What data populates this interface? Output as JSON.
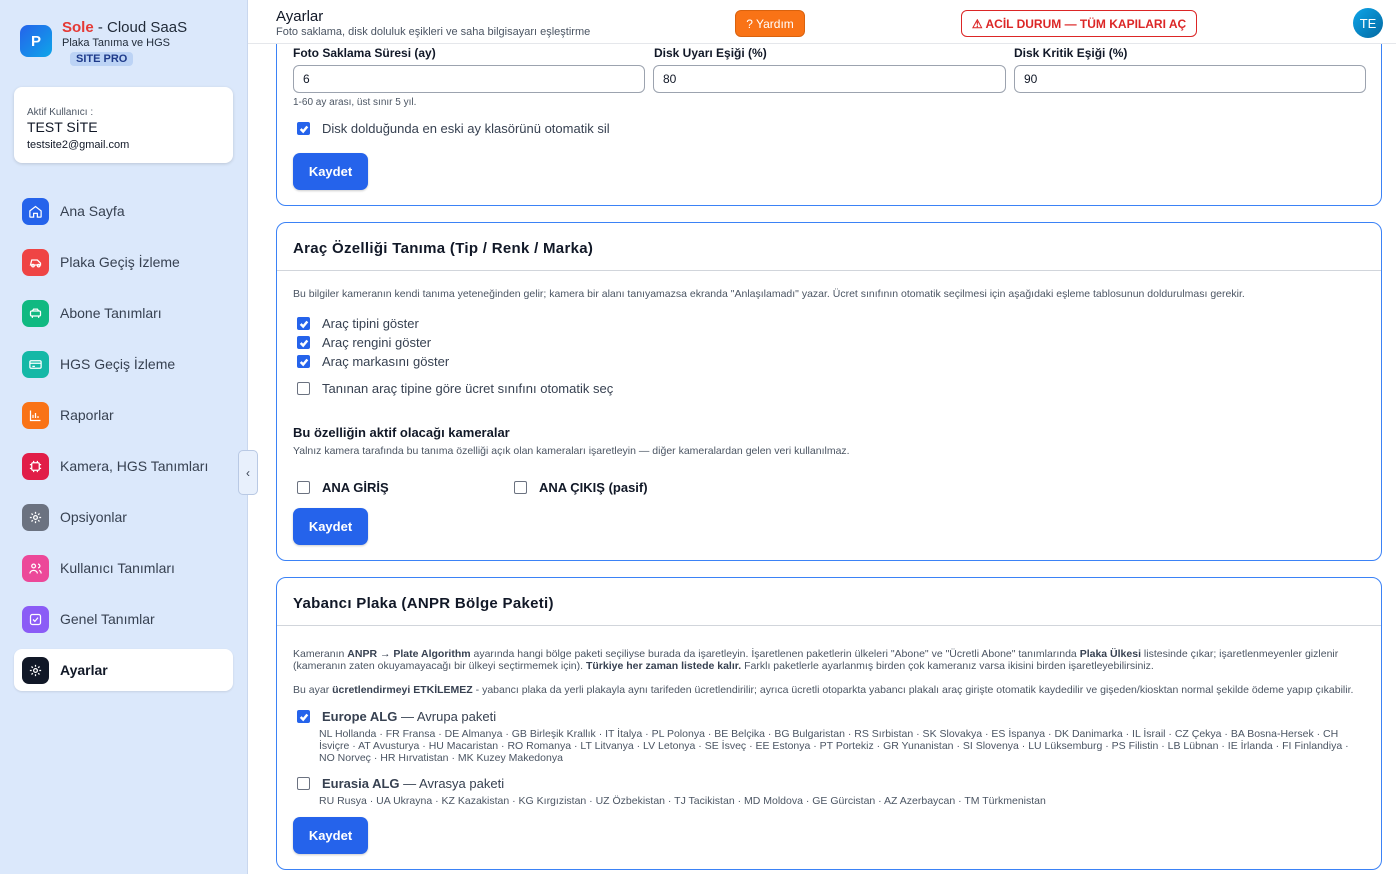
{
  "sidebar": {
    "brand": {
      "logo_letter": "P",
      "name_red": "Sole",
      "name_rest": " - Cloud SaaS",
      "subtitle": "Plaka Tanıma ve HGS",
      "badge": "SITE PRO"
    },
    "user": {
      "label": "Aktif Kullanıcı :",
      "name": "TEST SİTE",
      "email": "testsite2@gmail.com"
    },
    "items": [
      {
        "label": "Ana Sayfa",
        "icon": "home-icon",
        "color": "#2563eb"
      },
      {
        "label": "Plaka Geçiş İzleme",
        "icon": "car-icon",
        "color": "#ef4444"
      },
      {
        "label": "Abone Tanımları",
        "icon": "vehicle-icon",
        "color": "#10b981"
      },
      {
        "label": "HGS Geçiş İzleme",
        "icon": "card-icon",
        "color": "#14b8a6"
      },
      {
        "label": "Raporlar",
        "icon": "chart-icon",
        "color": "#f97316"
      },
      {
        "label": "Kamera, HGS Tanımları",
        "icon": "chip-icon",
        "color": "#e11d48"
      },
      {
        "label": "Opsiyonlar",
        "icon": "gear-icon",
        "color": "#6b7280"
      },
      {
        "label": "Kullanıcı Tanımları",
        "icon": "users-icon",
        "color": "#ec4899"
      },
      {
        "label": "Genel Tanımlar",
        "icon": "checklist-icon",
        "color": "#8b5cf6"
      },
      {
        "label": "Ayarlar",
        "icon": "settings-icon",
        "color": "#111827",
        "active": true
      }
    ],
    "collapse": "‹"
  },
  "header": {
    "title": "Ayarlar",
    "subtitle": "Foto saklama, disk doluluk eşikleri ve saha bilgisayarı eşleştirme",
    "help_label": "? Yardım",
    "emergency_label": "⚠ ACİL DURUM — TÜM KAPILARI AÇ",
    "avatar": "TE"
  },
  "storage": {
    "photo_label": "Foto Saklama Süresi (ay)",
    "photo_value": "6",
    "warn_label": "Disk Uyarı Eşiği (%)",
    "warn_value": "80",
    "crit_label": "Disk Kritik Eşiği (%)",
    "crit_value": "90",
    "hint": "1-60 ay arası, üst sınır 5 yıl.",
    "auto_delete_label": "Disk dolduğunda en eski ay klasörünü otomatik sil",
    "save": "Kaydet"
  },
  "vehicle": {
    "title": "Araç Özelliği Tanıma (Tip / Renk / Marka)",
    "desc": "Bu bilgiler kameranın kendi tanıma yeteneğinden gelir; kamera bir alanı tanıyamazsa ekranda \"Anlaşılamadı\" yazar. Ücret sınıfının otomatik seçilmesi için aşağıdaki eşleme tablosunun doldurulması gerekir.",
    "opt_type": "Araç tipini göster",
    "opt_color": "Araç rengini göster",
    "opt_brand": "Araç markasını göster",
    "opt_auto": "Tanınan araç tipine göre ücret sınıfını otomatik seç",
    "cameras_title": "Bu özelliğin aktif olacağı kameralar",
    "cameras_desc": "Yalnız kamera tarafında bu tanıma özelliği açık olan kameraları işaretleyin — diğer kameralardan gelen veri kullanılmaz.",
    "cam1": "ANA GİRİŞ",
    "cam2": "ANA ÇIKIŞ (pasif)",
    "save": "Kaydet"
  },
  "foreign": {
    "title": "Yabancı Plaka (ANPR Bölge Paketi)",
    "desc1_a": "Kameranın ",
    "desc1_b": "ANPR → Plate Algorithm",
    "desc1_c": " ayarında hangi bölge paketi seçiliyse burada da işaretleyin. İşaretlenen paketlerin ülkeleri \"Abone\" ve \"Ücretli Abone\" tanımlarında ",
    "desc1_d": "Plaka Ülkesi",
    "desc1_e": " listesinde çıkar; işaretlenmeyenler gizlenir (kameranın zaten okuyamayacağı bir ülkeyi seçtirmemek için). ",
    "desc1_f": "Türkiye her zaman listede kalır.",
    "desc1_g": " Farklı paketlerle ayarlanmış birden çok kameranız varsa ikisini birden işaretleyebilirsiniz.",
    "desc2_a": "Bu ayar ",
    "desc2_b": "ücretlendirmeyi ETKİLEMEZ",
    "desc2_c": " - yabancı plaka da yerli plakayla aynı tarifeden ücretlendirilir; ayrıca ücretli otoparkta yabancı plakalı araç girişte otomatik kaydedilir ve gişeden/kiosktan normal şekilde ödeme yapıp çıkabilir.",
    "pkg1_name": "Europe ALG",
    "pkg1_desc": " — Avrupa paketi",
    "pkg1_countries": "NL Hollanda · FR Fransa · DE Almanya · GB Birleşik Krallık · IT İtalya · PL Polonya · BE Belçika · BG Bulgaristan · RS Sırbistan · SK Slovakya · ES İspanya · DK Danimarka · IL İsrail · CZ Çekya · BA Bosna-Hersek · CH İsviçre · AT Avusturya · HU Macaristan · RO Romanya · LT Litvanya · LV Letonya · SE İsveç · EE Estonya · PT Portekiz · GR Yunanistan · SI Slovenya · LU Lüksemburg · PS Filistin · LB Lübnan · IE İrlanda · FI Finlandiya · NO Norveç · HR Hırvatistan · MK Kuzey Makedonya",
    "pkg2_name": "Eurasia ALG",
    "pkg2_desc": " — Avrasya paketi",
    "pkg2_countries": "RU Rusya · UA Ukrayna · KZ Kazakistan · KG Kırgızistan · UZ Özbekistan · TJ Tacikistan · MD Moldova · GE Gürcistan · AZ Azerbaycan · TM Türkmenistan",
    "save": "Kaydet"
  }
}
